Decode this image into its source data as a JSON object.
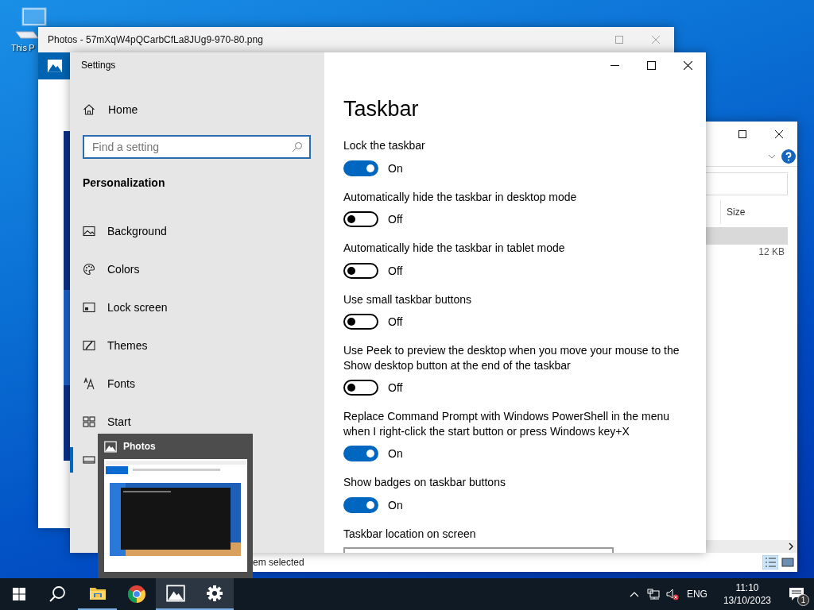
{
  "desktop": {
    "icons": [
      {
        "label": "This P"
      }
    ]
  },
  "photos_window": {
    "title": "Photos - 57mXqW4pQCarbCfLa8JUg9-970-80.png"
  },
  "explorer_window": {
    "column_header": "Size",
    "file_size": "12 KB",
    "status": "em selected"
  },
  "settings_window": {
    "title": "Settings",
    "sidebar": {
      "home": "Home",
      "search": {
        "placeholder": "Find a setting"
      },
      "section": "Personalization",
      "items": [
        {
          "label": "Background",
          "selected": false
        },
        {
          "label": "Colors",
          "selected": false
        },
        {
          "label": "Lock screen",
          "selected": false
        },
        {
          "label": "Themes",
          "selected": false
        },
        {
          "label": "Fonts",
          "selected": false
        },
        {
          "label": "Start",
          "selected": false
        },
        {
          "selected": true
        }
      ]
    },
    "page_title": "Taskbar",
    "settings": [
      {
        "kind": "toggle",
        "label": "Lock the taskbar",
        "on": true,
        "state_text": "On"
      },
      {
        "kind": "toggle",
        "label": "Automatically hide the taskbar in desktop mode",
        "on": false,
        "state_text": "Off"
      },
      {
        "kind": "toggle",
        "label": "Automatically hide the taskbar in tablet mode",
        "on": false,
        "state_text": "Off"
      },
      {
        "kind": "toggle",
        "label": "Use small taskbar buttons",
        "on": false,
        "state_text": "Off"
      },
      {
        "kind": "toggle",
        "label": "Use Peek to preview the desktop when you move your mouse to the Show desktop button at the end of the taskbar",
        "on": false,
        "state_text": "Off"
      },
      {
        "kind": "toggle",
        "label": "Replace Command Prompt with Windows PowerShell in the menu when I right-click the start button or press Windows key+X",
        "on": true,
        "state_text": "On"
      },
      {
        "kind": "toggle",
        "label": "Show badges on taskbar buttons",
        "on": true,
        "state_text": "On"
      },
      {
        "kind": "dropdown",
        "label": "Taskbar location on screen"
      }
    ]
  },
  "thumbnail_preview": {
    "title": "Photos"
  },
  "taskbar": {
    "apps": [
      {
        "kind": "explorer",
        "running": true,
        "highlighted": false
      },
      {
        "kind": "chrome",
        "running": false,
        "highlighted": false
      },
      {
        "kind": "photos",
        "running": true,
        "highlighted": true
      },
      {
        "kind": "settings",
        "running": true,
        "highlighted": true
      }
    ],
    "tray": {
      "language": "ENG",
      "time": "11:10",
      "date": "13/10/2023",
      "notification_count": "1"
    }
  }
}
